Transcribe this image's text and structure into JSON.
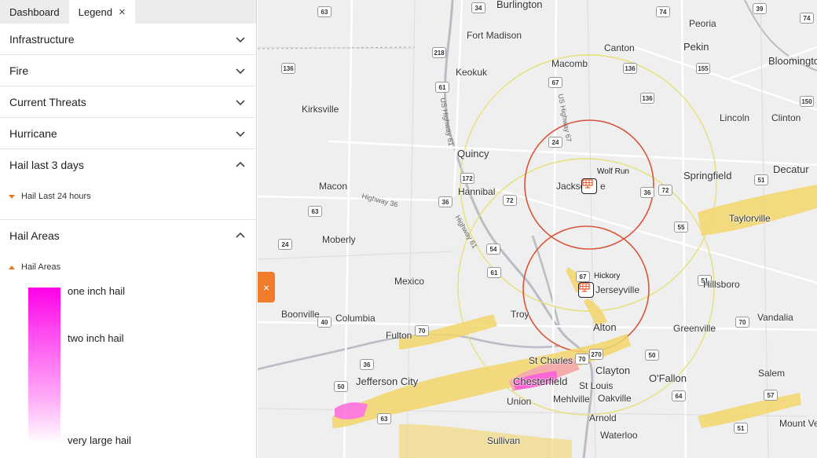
{
  "tabs": [
    {
      "label": "Dashboard"
    },
    {
      "label": "Legend"
    }
  ],
  "sections": {
    "infrastructure": "Infrastructure",
    "fire": "Fire",
    "current_threats": "Current Threats",
    "hurricane": "Hurricane",
    "hail3": "Hail last 3 days",
    "hail24": "Hail Last 24 hours",
    "hail_areas": "Hail Areas",
    "hail_areas_sub": "Hail Areas"
  },
  "gradient": {
    "top": "one inch hail",
    "mid": "two inch hail",
    "bottom": "very large hail"
  },
  "handle": {
    "label": "×"
  },
  "map": {
    "cities": [
      {
        "name": "Burlington"
      },
      {
        "name": "Peoria"
      },
      {
        "name": "Fort Madison"
      },
      {
        "name": "Canton"
      },
      {
        "name": "Pekin"
      },
      {
        "name": "Bloomington"
      },
      {
        "name": "Keokuk"
      },
      {
        "name": "Macomb"
      },
      {
        "name": "Kirksville"
      },
      {
        "name": "Lincoln"
      },
      {
        "name": "Clinton"
      },
      {
        "name": "Quincy"
      },
      {
        "name": "Springfield"
      },
      {
        "name": "Decatur"
      },
      {
        "name": "Macon"
      },
      {
        "name": "Hannibal"
      },
      {
        "name": "Jackso"
      },
      {
        "name": "e"
      },
      {
        "name": "Taylorville"
      },
      {
        "name": "Moberly"
      },
      {
        "name": "Mexico"
      },
      {
        "name": "Jerseyville"
      },
      {
        "name": "Hillsboro"
      },
      {
        "name": "Boonville"
      },
      {
        "name": "Columbia"
      },
      {
        "name": "Troy"
      },
      {
        "name": "Alton"
      },
      {
        "name": "Greenville"
      },
      {
        "name": "Vandalia"
      },
      {
        "name": "Fulton"
      },
      {
        "name": "St Charles"
      },
      {
        "name": "Clayton"
      },
      {
        "name": "Jefferson City"
      },
      {
        "name": "Chesterfield"
      },
      {
        "name": "St Louis"
      },
      {
        "name": "O'Fallon"
      },
      {
        "name": "Salem"
      },
      {
        "name": "Union"
      },
      {
        "name": "Mehlville"
      },
      {
        "name": "Oakville"
      },
      {
        "name": "Arnold"
      },
      {
        "name": "Waterloo"
      },
      {
        "name": "Sullivan"
      },
      {
        "name": "Mount Ver"
      }
    ],
    "roads": [
      {
        "label": "Highway 36"
      },
      {
        "label": "US Highway 61"
      },
      {
        "label": "Highway 61"
      },
      {
        "label": "US Highway 67"
      }
    ],
    "shields": [
      "63",
      "34",
      "74",
      "39",
      "74",
      "136",
      "218",
      "61",
      "136",
      "155",
      "67",
      "136",
      "150",
      "24",
      "72",
      "172",
      "36",
      "72",
      "51",
      "63",
      "36",
      "36",
      "55",
      "24",
      "54",
      "61",
      "67",
      "51",
      "70",
      "40",
      "70",
      "270",
      "70",
      "50",
      "63",
      "64",
      "57",
      "51",
      "50"
    ],
    "sites": [
      {
        "name": "Wolf Run"
      },
      {
        "name": "Hickory"
      }
    ]
  }
}
